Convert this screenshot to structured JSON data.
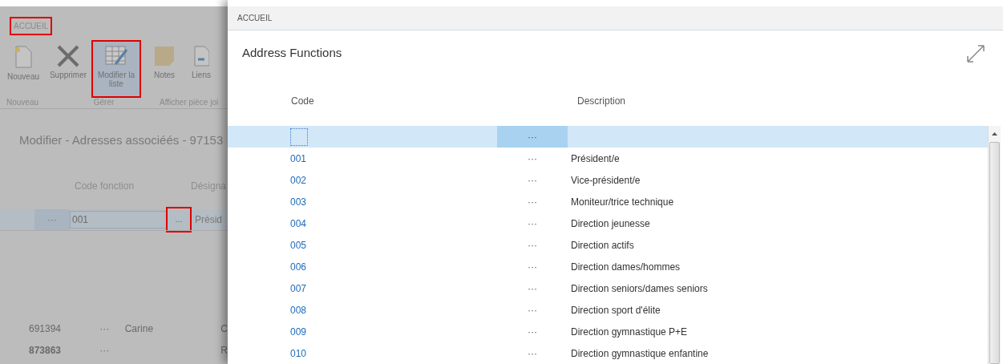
{
  "background_page": {
    "ribbon_tab": {
      "label": "ACCUEIL",
      "highlighted": true
    },
    "ribbon_buttons": [
      {
        "kind": "new",
        "label": "Nouveau",
        "highlighted": false
      },
      {
        "kind": "delete",
        "label": "Supprimer",
        "highlighted": false
      },
      {
        "kind": "edit_list",
        "label": "Modifier la liste",
        "highlighted": true
      },
      {
        "kind": "notes",
        "label": "Notes",
        "highlighted": false
      },
      {
        "kind": "links",
        "label": "Liens",
        "highlighted": false
      }
    ],
    "ribbon_groups": [
      "Nouveau",
      "Gérer",
      "Afficher pièce joi"
    ],
    "title": "Modifier - Adresses associéés - 97153",
    "columns": [
      "Code fonction",
      "Désigna"
    ],
    "edit_row": {
      "dots": "···",
      "value": "001",
      "lookup": "...",
      "lookup_highlighted": true,
      "description": "Présid"
    },
    "list_rows": [
      {
        "number": "691394",
        "dots": "···",
        "name": "Carine",
        "column_4": "C",
        "bold": false
      },
      {
        "number": "873863",
        "dots": "···",
        "name": "",
        "column_4": "R",
        "bold": true
      }
    ]
  },
  "dialog": {
    "tab": "ACCUEIL",
    "title": "Address Functions",
    "columns": [
      "Code",
      "Description"
    ],
    "rows": [
      {
        "code": "",
        "dots": "···",
        "description": "",
        "selected": true
      },
      {
        "code": "001",
        "dots": "···",
        "description": "Président/e",
        "selected": false
      },
      {
        "code": "002",
        "dots": "···",
        "description": "Vice-président/e",
        "selected": false
      },
      {
        "code": "003",
        "dots": "···",
        "description": "Moniteur/trice technique",
        "selected": false
      },
      {
        "code": "004",
        "dots": "···",
        "description": "Direction jeunesse",
        "selected": false
      },
      {
        "code": "005",
        "dots": "···",
        "description": "Direction actifs",
        "selected": false
      },
      {
        "code": "006",
        "dots": "···",
        "description": "Direction dames/hommes",
        "selected": false
      },
      {
        "code": "007",
        "dots": "···",
        "description": "Direction seniors/dames seniors",
        "selected": false
      },
      {
        "code": "008",
        "dots": "···",
        "description": "Direction sport d'élite",
        "selected": false
      },
      {
        "code": "009",
        "dots": "···",
        "description": "Direction gymnastique P+E",
        "selected": false
      },
      {
        "code": "010",
        "dots": "···",
        "description": "Direction gymnastique enfantine",
        "selected": false
      }
    ]
  }
}
